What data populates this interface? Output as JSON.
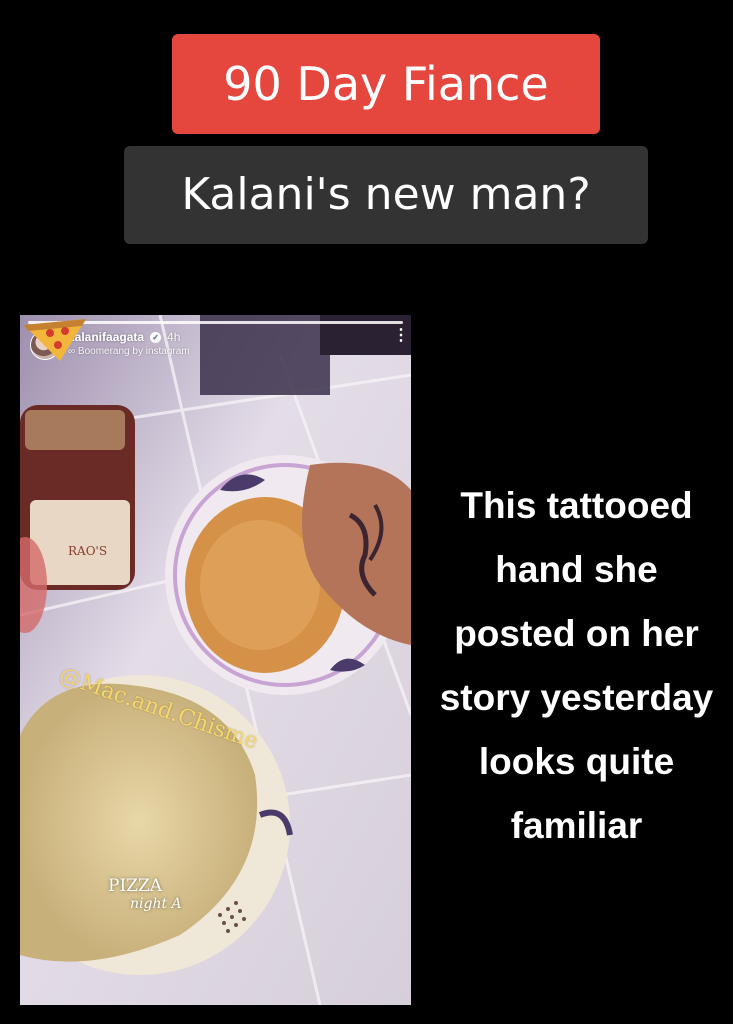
{
  "title": "90 Day Fiance",
  "subtitle": "Kalani's new man?",
  "story": {
    "username": "kalanifaagata",
    "time": "4h",
    "subtext": "Boomerang by instagram",
    "jar_label": "RAO'S",
    "watermark": "@Mac.and.Chisme",
    "sticker_line1": "PIZZA",
    "sticker_line2": "night A"
  },
  "caption_lines": [
    "This tattooed",
    "hand she",
    "posted on her",
    "story yesterday",
    "looks quite",
    "familiar"
  ],
  "colors": {
    "title_bg": "#e5473f",
    "subtitle_bg": "#333333",
    "watermark": "#f5d76b"
  },
  "icons": [
    "verified-icon",
    "more-options-icon",
    "pizza-slice-icon",
    "avatar"
  ]
}
